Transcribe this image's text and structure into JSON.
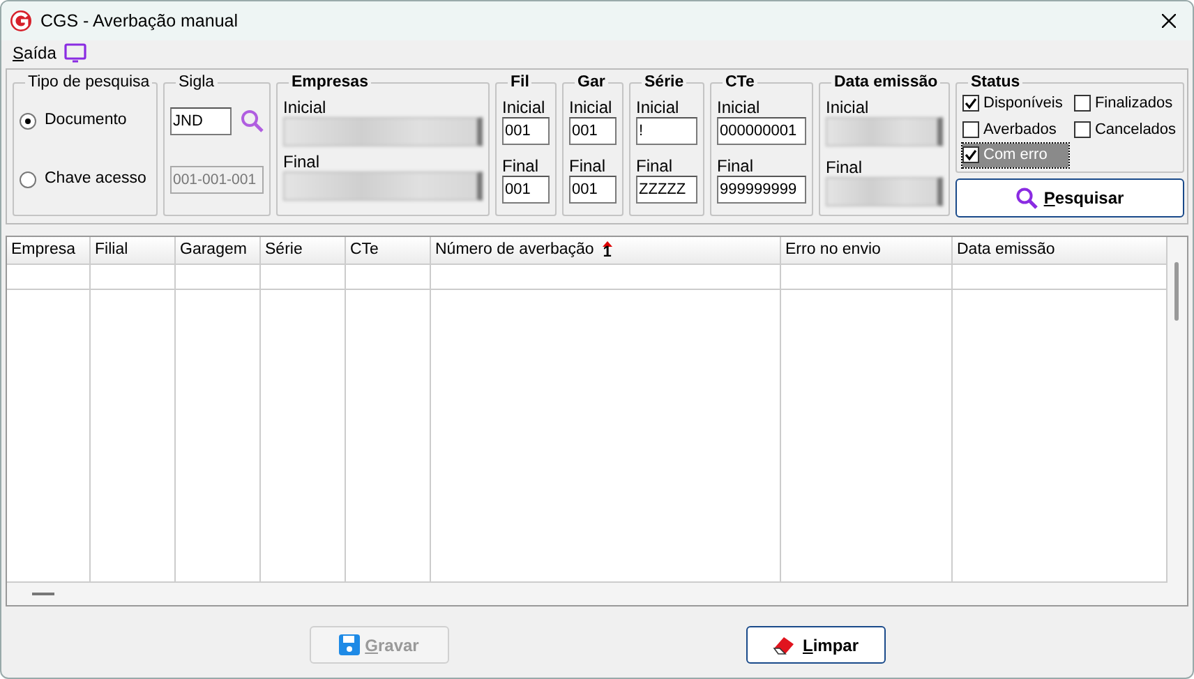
{
  "window": {
    "title": "CGS -  Averbação manual"
  },
  "menu": [
    {
      "label": "Saída"
    }
  ],
  "search_type": {
    "title": "Tipo de pesquisa",
    "options": [
      {
        "label": "Documento",
        "selected": true
      },
      {
        "label": "Chave acesso",
        "selected": false
      }
    ]
  },
  "sigla": {
    "title": "Sigla",
    "value": "JND",
    "code": "001-001-001"
  },
  "empresas": {
    "title": "Empresas",
    "fields": [
      {
        "label": "Inicial"
      },
      {
        "label": "Final"
      }
    ]
  },
  "ranges": [
    {
      "title": "Fil",
      "start_label": "Inicial",
      "start": "001",
      "end_label": "Final",
      "end": "001"
    },
    {
      "title": "Gar",
      "start_label": "Inicial",
      "start": "001",
      "end_label": "Final",
      "end": "001"
    },
    {
      "title": "Série",
      "start_label": "Inicial",
      "start": "!",
      "end_label": "Final",
      "end": "ZZZZZ"
    },
    {
      "title": "CTe",
      "start_label": "Inicial",
      "start": "000000001",
      "end_label": "Final",
      "end": "999999999"
    }
  ],
  "data_emissao": {
    "title": "Data emissão",
    "fields": [
      {
        "label": "Inicial"
      },
      {
        "label": "Final"
      }
    ]
  },
  "status": {
    "title": "Status",
    "options": [
      {
        "label": "Disponíveis",
        "checked": true,
        "focused": false
      },
      {
        "label": "Finalizados",
        "checked": false,
        "focused": false
      },
      {
        "label": "Averbados",
        "checked": false,
        "focused": false
      },
      {
        "label": "Cancelados",
        "checked": false,
        "focused": false
      },
      {
        "label": "Com erro",
        "checked": true,
        "focused": true
      }
    ]
  },
  "search_button": {
    "label": "Pesquisar"
  },
  "table": {
    "columns": [
      {
        "label": "Empresa",
        "sorted": false
      },
      {
        "label": "Filial",
        "sorted": false
      },
      {
        "label": "Garagem",
        "sorted": false
      },
      {
        "label": "Série",
        "sorted": false
      },
      {
        "label": "CTe",
        "sorted": false
      },
      {
        "label": "Número de averbação",
        "sorted": true,
        "sort_order": "1"
      },
      {
        "label": "Erro no envio",
        "sorted": false
      },
      {
        "label": "Data emissão",
        "sorted": false
      }
    ]
  },
  "buttons": [
    {
      "label": "Gravar",
      "kind": "save",
      "disabled": true
    },
    {
      "label": "Limpar",
      "kind": "clear",
      "disabled": false
    }
  ]
}
